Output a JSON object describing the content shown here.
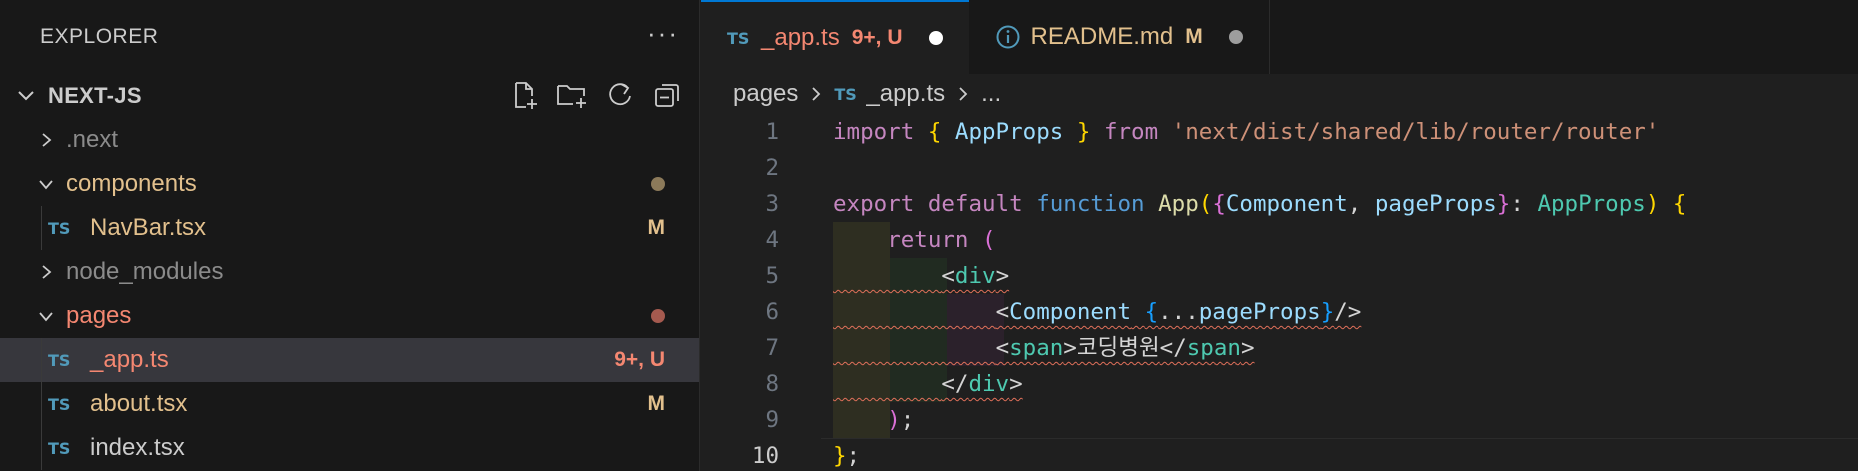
{
  "explorer": {
    "title": "EXPLORER",
    "more": "···",
    "project": "NEXT-JS",
    "actions": [
      "new-file-icon",
      "new-folder-icon",
      "refresh-icon",
      "collapse-all-icon"
    ],
    "tree": [
      {
        "type": "folder",
        "name": ".next",
        "expanded": false,
        "color": "#8b8b8b"
      },
      {
        "type": "folder",
        "name": "components",
        "expanded": true,
        "color": "#e2c08d",
        "dot": "#8c7a5a"
      },
      {
        "type": "file",
        "badge": "TS",
        "name": "NavBar.tsx",
        "status": "M",
        "color": "#e2c08d",
        "status_color": "#e2c08d"
      },
      {
        "type": "folder",
        "name": "node_modules",
        "expanded": false,
        "color": "#8b8b8b"
      },
      {
        "type": "folder",
        "name": "pages",
        "expanded": true,
        "color": "#f48771",
        "dot": "#a55a4f"
      },
      {
        "type": "file",
        "badge": "TS",
        "name": "_app.ts",
        "status": "9+, U",
        "color": "#f48771",
        "status_color": "#f48771",
        "selected": true
      },
      {
        "type": "file",
        "badge": "TS",
        "name": "about.tsx",
        "status": "M",
        "color": "#e2c08d",
        "status_color": "#e2c08d"
      },
      {
        "type": "file",
        "badge": "TS",
        "name": "index.tsx",
        "color": "#cccccc"
      }
    ]
  },
  "tabs": [
    {
      "badge": "TS",
      "name": "_app.ts",
      "status": "9+, U",
      "color": "#f48771",
      "dot": "#ffffff",
      "active": true
    },
    {
      "icon": "info-icon",
      "name": "README.md",
      "status": "M",
      "color": "#e2c08d",
      "dot": "#9d9d9d",
      "active": false
    }
  ],
  "breadcrumb": {
    "folder": "pages",
    "badge": "TS",
    "file": "_app.ts",
    "rest": "..."
  },
  "code": {
    "current_line": 10,
    "lines": [
      {
        "n": "1",
        "tokens": [
          [
            "kw",
            "import"
          ],
          [
            "punc",
            " "
          ],
          [
            "br1",
            "{"
          ],
          [
            "punc",
            " "
          ],
          [
            "var",
            "AppProps"
          ],
          [
            "punc",
            " "
          ],
          [
            "br1",
            "}"
          ],
          [
            "punc",
            " "
          ],
          [
            "kw",
            "from"
          ],
          [
            "punc",
            " "
          ],
          [
            "str",
            "'next/dist/shared/lib/router/router'"
          ]
        ]
      },
      {
        "n": "2",
        "tokens": []
      },
      {
        "n": "3",
        "tokens": [
          [
            "kw",
            "export"
          ],
          [
            "punc",
            " "
          ],
          [
            "kw",
            "default"
          ],
          [
            "punc",
            " "
          ],
          [
            "kw-blue",
            "function"
          ],
          [
            "punc",
            " "
          ],
          [
            "fn",
            "App"
          ],
          [
            "br1",
            "("
          ],
          [
            "br2",
            "{"
          ],
          [
            "var",
            "Component"
          ],
          [
            "punc",
            ", "
          ],
          [
            "var",
            "pageProps"
          ],
          [
            "br2",
            "}"
          ],
          [
            "punc",
            ": "
          ],
          [
            "type",
            "AppProps"
          ],
          [
            "br1",
            ")"
          ],
          [
            "punc",
            " "
          ],
          [
            "br1",
            "{"
          ]
        ]
      },
      {
        "n": "4",
        "tokens": [
          [
            "punc",
            "    "
          ],
          [
            "kw",
            "return"
          ],
          [
            "punc",
            " "
          ],
          [
            "br2",
            "("
          ]
        ]
      },
      {
        "n": "5",
        "tokens": [
          [
            "punc",
            "        "
          ],
          [
            "punc",
            "<"
          ],
          [
            "tag",
            "div"
          ],
          [
            "punc",
            ">"
          ]
        ]
      },
      {
        "n": "6",
        "tokens": [
          [
            "punc",
            "            "
          ],
          [
            "punc",
            "<"
          ],
          [
            "var",
            "Component"
          ],
          [
            "punc",
            " "
          ],
          [
            "br3",
            "{"
          ],
          [
            "punc",
            "..."
          ],
          [
            "var",
            "pageProps"
          ],
          [
            "br3",
            "}"
          ],
          [
            "punc",
            "/>"
          ]
        ]
      },
      {
        "n": "7",
        "tokens": [
          [
            "punc",
            "            "
          ],
          [
            "punc",
            "<"
          ],
          [
            "tag",
            "span"
          ],
          [
            "punc",
            ">"
          ],
          [
            "punc",
            "코딩병원"
          ],
          [
            "punc",
            "</"
          ],
          [
            "tag",
            "span"
          ],
          [
            "punc",
            ">"
          ]
        ]
      },
      {
        "n": "8",
        "tokens": [
          [
            "punc",
            "        "
          ],
          [
            "punc",
            "</"
          ],
          [
            "tag",
            "div"
          ],
          [
            "punc",
            ">"
          ]
        ]
      },
      {
        "n": "9",
        "tokens": [
          [
            "punc",
            "    "
          ],
          [
            "br2",
            ")"
          ],
          [
            "punc",
            ";"
          ]
        ]
      },
      {
        "n": "10",
        "tokens": [
          [
            "br1",
            "}"
          ],
          [
            "punc",
            ";"
          ]
        ]
      }
    ]
  }
}
